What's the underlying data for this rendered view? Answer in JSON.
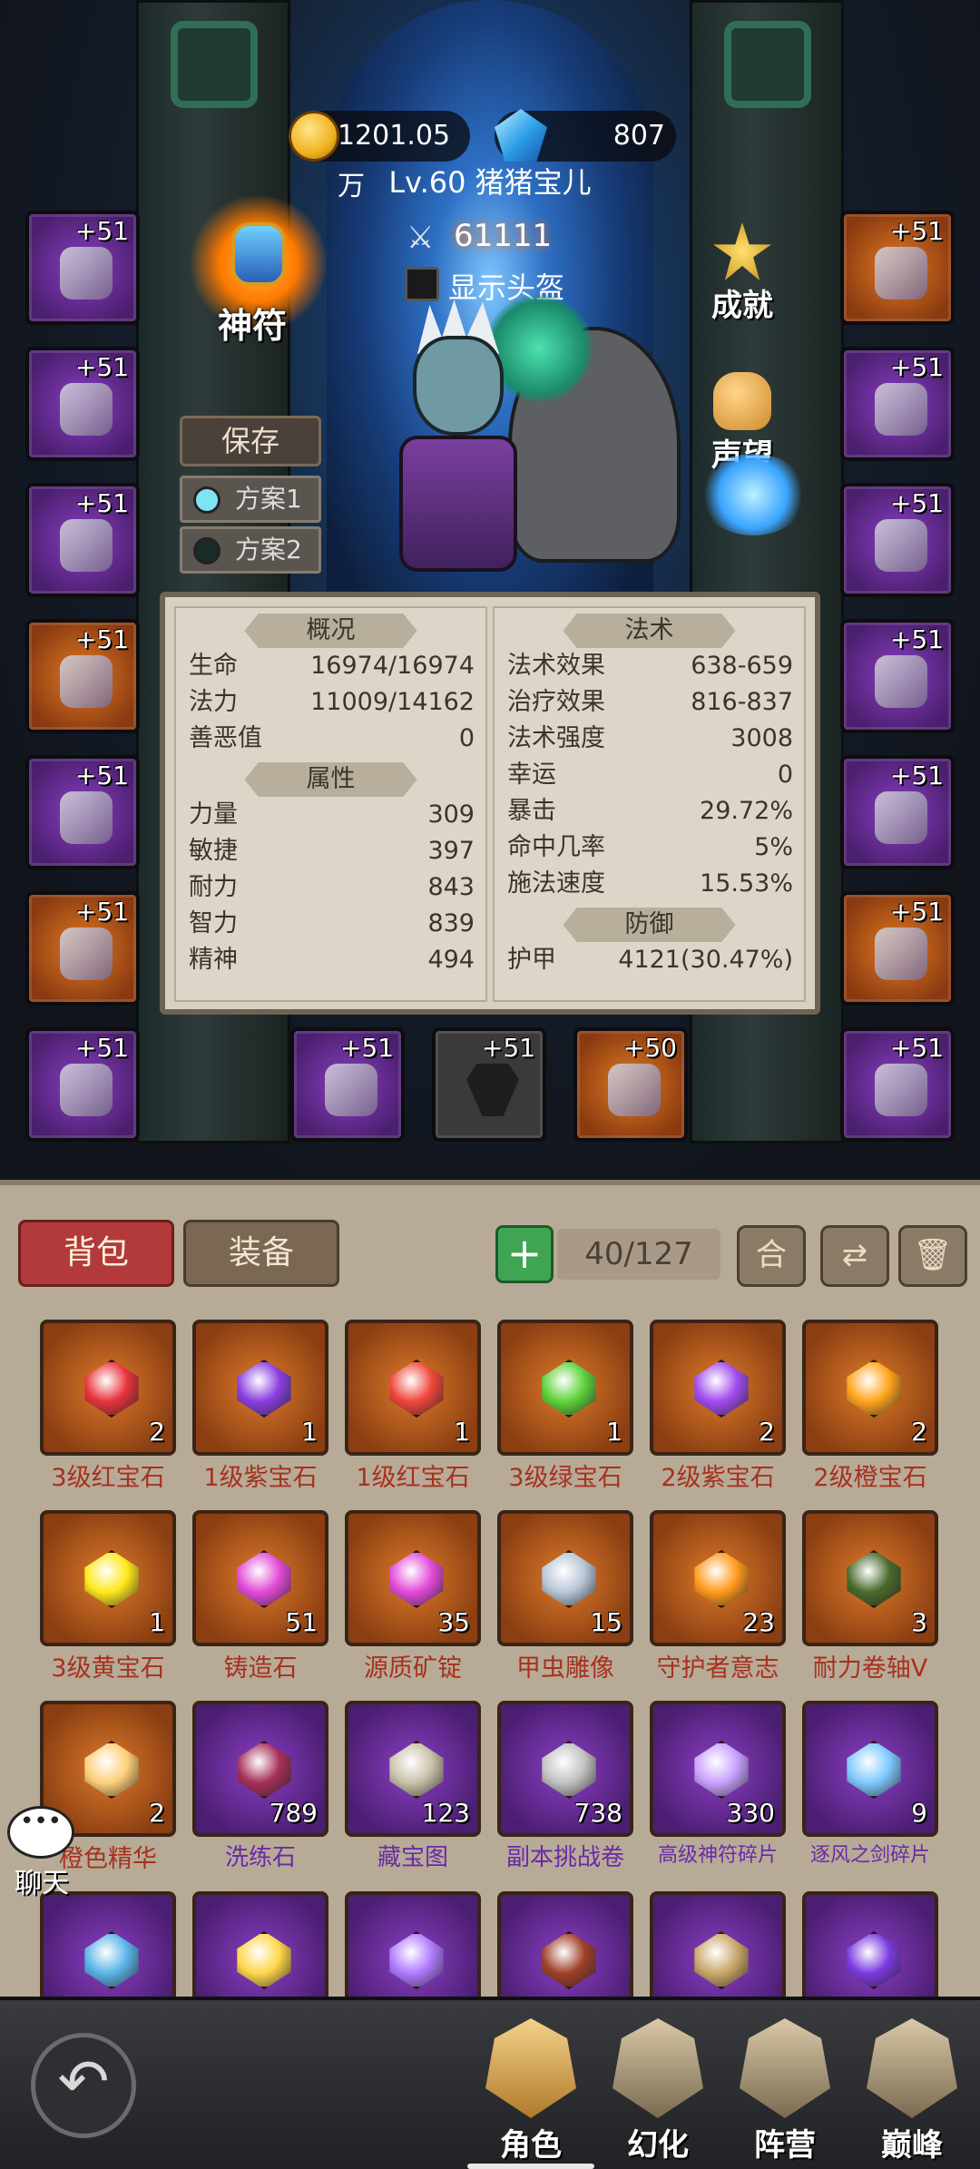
{
  "currency": {
    "gold": "1201.05万",
    "diamonds": "807"
  },
  "player": {
    "level_name": "Lv.60 猪猪宝儿",
    "power": "61111",
    "show_helmet_label": "显示头盔"
  },
  "amulet_label": "神符",
  "side_buttons": {
    "achievement": "成就",
    "reputation": "声望"
  },
  "save_label": "保存",
  "plans": [
    "方案1",
    "方案2"
  ],
  "equipment": {
    "left": [
      "+51",
      "+51",
      "+51",
      "+51",
      "+51",
      "+51",
      "+51"
    ],
    "right": [
      "+51",
      "+51",
      "+51",
      "+51",
      "+51",
      "+51",
      "+51"
    ],
    "bottom": [
      "+51",
      "+51",
      "+50"
    ]
  },
  "stats": {
    "overview": {
      "title": "概况",
      "rows": [
        {
          "k": "生命",
          "v": "16974/16974"
        },
        {
          "k": "法力",
          "v": "11009/14162"
        },
        {
          "k": "善恶值",
          "v": "0"
        }
      ]
    },
    "attributes": {
      "title": "属性",
      "rows": [
        {
          "k": "力量",
          "v": "309"
        },
        {
          "k": "敏捷",
          "v": "397"
        },
        {
          "k": "耐力",
          "v": "843"
        },
        {
          "k": "智力",
          "v": "839"
        },
        {
          "k": "精神",
          "v": "494"
        }
      ]
    },
    "magic": {
      "title": "法术",
      "rows": [
        {
          "k": "法术效果",
          "v": "638-659"
        },
        {
          "k": "治疗效果",
          "v": "816-837"
        },
        {
          "k": "法术强度",
          "v": "3008"
        },
        {
          "k": "幸运",
          "v": "0"
        },
        {
          "k": "暴击",
          "v": "29.72%"
        },
        {
          "k": "命中几率",
          "v": "5%"
        },
        {
          "k": "施法速度",
          "v": "15.53%"
        }
      ]
    },
    "defense": {
      "title": "防御",
      "rows": [
        {
          "k": "护甲",
          "v": "4121(30.47%)"
        }
      ]
    }
  },
  "bag": {
    "tabs": {
      "backpack": "背包",
      "equipment": "装备"
    },
    "add": "+",
    "capacity": "40/127",
    "merge": "合",
    "items": [
      {
        "name": "3级红宝石",
        "count": "2",
        "color": "#e8333b"
      },
      {
        "name": "1级紫宝石",
        "count": "1",
        "color": "#8a3ee0"
      },
      {
        "name": "1级红宝石",
        "count": "1",
        "color": "#f0463a"
      },
      {
        "name": "3级绿宝石",
        "count": "1",
        "color": "#5fd23a"
      },
      {
        "name": "2级紫宝石",
        "count": "2",
        "color": "#a14bf0"
      },
      {
        "name": "2级橙宝石",
        "count": "2",
        "color": "#ffa41c"
      },
      {
        "name": "3级黄宝石",
        "count": "1",
        "color": "#ffe81c"
      },
      {
        "name": "铸造石",
        "count": "51",
        "color": "#e24ad8"
      },
      {
        "name": "源质矿锭",
        "count": "35",
        "color": "#e24ad8"
      },
      {
        "name": "甲虫雕像",
        "count": "15",
        "color": "#b8c6d6"
      },
      {
        "name": "守护者意志",
        "count": "23",
        "color": "#ff9a1c"
      },
      {
        "name": "耐力卷轴V",
        "count": "3",
        "color": "#4a6a2c"
      },
      {
        "name": "橙色精华",
        "count": "2",
        "color": "#ffcf7a"
      },
      {
        "name": "洗练石",
        "count": "789",
        "color": "#a53058"
      },
      {
        "name": "藏宝图",
        "count": "123",
        "color": "#c9c1a8"
      },
      {
        "name": "副本挑战卷",
        "count": "738",
        "color": "#c2c2c2"
      },
      {
        "name": "高级神符碎片",
        "count": "330",
        "color": "#c9a2ff"
      },
      {
        "name": "逐风之剑碎片",
        "count": "9",
        "color": "#7ec9ff"
      },
      {
        "name": "",
        "count": "",
        "color": "#5ab4e8"
      },
      {
        "name": "",
        "count": "",
        "color": "#ffd64a"
      },
      {
        "name": "",
        "count": "",
        "color": "#b07aff"
      },
      {
        "name": "",
        "count": "",
        "color": "#a0402a"
      },
      {
        "name": "",
        "count": "",
        "color": "#c9a86a"
      },
      {
        "name": "",
        "count": "",
        "color": "#7a3ae0"
      }
    ]
  },
  "chat_label": "聊天",
  "nav": {
    "character": "角色",
    "illusion": "幻化",
    "camp": "阵营",
    "peak": "巅峰"
  },
  "icons": {
    "back": "back-arrow-icon",
    "trash": "trash-icon",
    "sort": "sort-icon"
  }
}
